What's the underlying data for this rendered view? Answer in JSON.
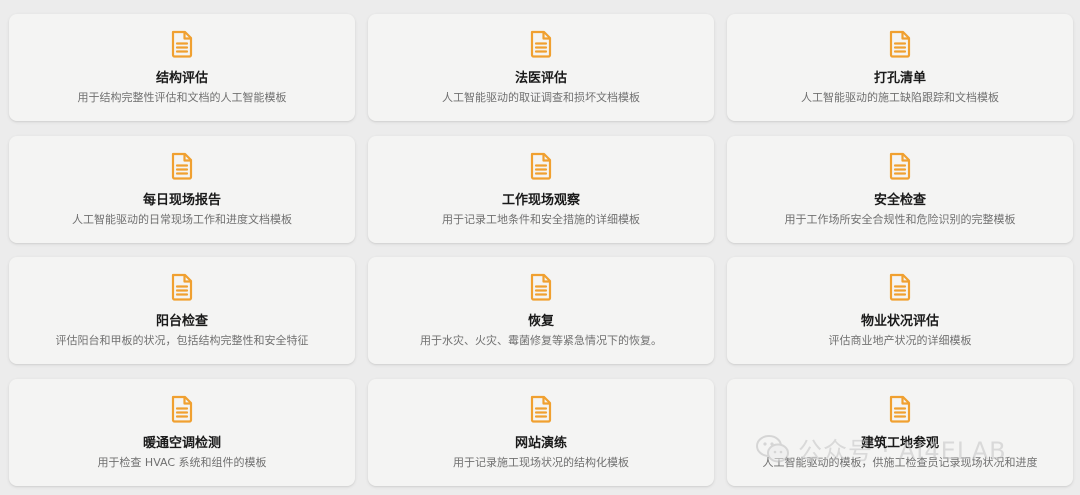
{
  "templates": [
    {
      "title": "结构评估",
      "description": "用于结构完整性评估和文档的人工智能模板",
      "icon": "document-icon"
    },
    {
      "title": "法医评估",
      "description": "人工智能驱动的取证调查和损坏文档模板",
      "icon": "document-icon"
    },
    {
      "title": "打孔清单",
      "description": "人工智能驱动的施工缺陷跟踪和文档模板",
      "icon": "document-icon"
    },
    {
      "title": "每日现场报告",
      "description": "人工智能驱动的日常现场工作和进度文档模板",
      "icon": "document-icon"
    },
    {
      "title": "工作现场观察",
      "description": "用于记录工地条件和安全措施的详细模板",
      "icon": "document-icon"
    },
    {
      "title": "安全检查",
      "description": "用于工作场所安全合规性和危险识别的完整模板",
      "icon": "document-icon"
    },
    {
      "title": "阳台检查",
      "description": "评估阳台和甲板的状况，包括结构完整性和安全特征",
      "icon": "document-icon"
    },
    {
      "title": "恢复",
      "description": "用于水灾、火灾、霉菌修复等紧急情况下的恢复。",
      "icon": "document-icon"
    },
    {
      "title": "物业状况评估",
      "description": "评估商业地产状况的详细模板",
      "icon": "document-icon"
    },
    {
      "title": "暖通空调检测",
      "description": "用于检查 HVAC 系统和组件的模板",
      "icon": "document-icon"
    },
    {
      "title": "网站演练",
      "description": "用于记录施工现场状况的结构化模板",
      "icon": "document-icon"
    },
    {
      "title": "建筑工地参观",
      "description": "人工智能驱动的模板，供施工检查员记录现场状况和进度",
      "icon": "document-icon"
    }
  ],
  "watermark": {
    "text": "公众号 · AI4ELAB",
    "icon": "wechat-icon"
  },
  "colors": {
    "accent": "#f0a030",
    "title": "#1a1a1a",
    "description": "#707070",
    "card": "#f4f4f3",
    "background": "#ececec"
  }
}
